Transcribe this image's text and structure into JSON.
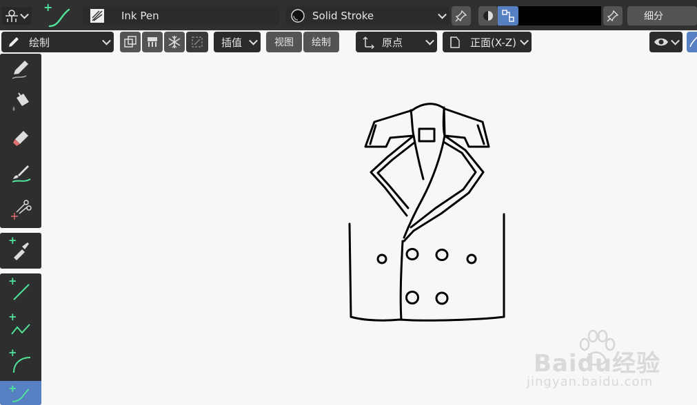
{
  "header": {
    "brush_name": "Ink Pen",
    "stroke_material": "Solid Stroke",
    "subdivide_label": "细分"
  },
  "toolbar2": {
    "mode_label": "绘制",
    "interpolate_label": "插值",
    "view_label": "视图",
    "draw_label": "绘制",
    "origin_label": "原点",
    "plane_label": "正面(X-Z)"
  },
  "tools": [
    {
      "name": "draw-tool",
      "icon": "pencil-icon"
    },
    {
      "name": "fill-tool",
      "icon": "paint-bucket-icon"
    },
    {
      "name": "erase-tool",
      "icon": "eraser-icon"
    },
    {
      "name": "tint-tool",
      "icon": "brush-tint-icon"
    },
    {
      "name": "cutter-tool",
      "icon": "scissors-icon"
    },
    {
      "name": "eyedropper-tool",
      "icon": "eyedropper-icon"
    },
    {
      "name": "line-tool",
      "icon": "line-icon"
    },
    {
      "name": "polyline-tool",
      "icon": "polyline-icon"
    },
    {
      "name": "arc-tool",
      "icon": "arc-icon"
    },
    {
      "name": "curve-tool",
      "icon": "curve-icon"
    }
  ],
  "colors": {
    "accent": "#5680c2",
    "add_green": "#4fe49a",
    "panel": "#303030",
    "canvas": "#f7f7f7"
  },
  "watermark": {
    "brand": "Baidu经验",
    "url": "jingyan.baidu.com"
  }
}
